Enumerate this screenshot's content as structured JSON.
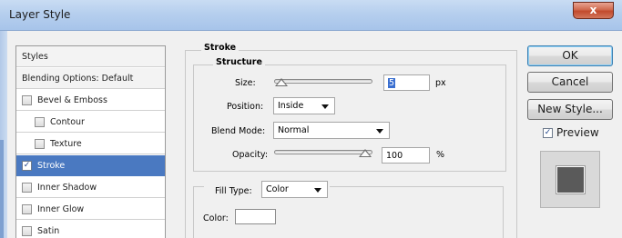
{
  "window": {
    "title": "Layer Style",
    "close_glyph": "x"
  },
  "styles_list": {
    "items": [
      {
        "label": "Styles",
        "type": "header",
        "checked": false
      },
      {
        "label": "Blending Options: Default",
        "type": "header",
        "checked": false
      },
      {
        "label": "Bevel & Emboss",
        "type": "checkbox",
        "checked": false
      },
      {
        "label": "Contour",
        "type": "checkbox-sub",
        "checked": false
      },
      {
        "label": "Texture",
        "type": "checkbox-sub",
        "checked": false
      },
      {
        "label": "Stroke",
        "type": "checkbox",
        "checked": true,
        "selected": true
      },
      {
        "label": "Inner Shadow",
        "type": "checkbox",
        "checked": false
      },
      {
        "label": "Inner Glow",
        "type": "checkbox",
        "checked": false
      },
      {
        "label": "Satin",
        "type": "checkbox",
        "checked": false
      }
    ],
    "selected_color": "#4a79c1"
  },
  "stroke": {
    "group_title": "Stroke",
    "structure_title": "Structure",
    "size": {
      "label": "Size:",
      "value": "5",
      "unit": "px",
      "slider_fraction": 0.0
    },
    "position": {
      "label": "Position:",
      "value": "Inside"
    },
    "blend_mode": {
      "label": "Blend Mode:",
      "value": "Normal"
    },
    "opacity": {
      "label": "Opacity:",
      "value": "100",
      "unit": "%",
      "slider_fraction": 1.0
    },
    "fill_type": {
      "label": "Fill Type:",
      "value": "Color"
    },
    "color": {
      "label": "Color:",
      "value": "#ffffff"
    }
  },
  "buttons": {
    "ok": "OK",
    "cancel": "Cancel",
    "new_style": "New Style..."
  },
  "preview": {
    "label": "Preview",
    "checked": true,
    "check_glyph": "✓",
    "swatch_color": "#5a5a5a"
  }
}
